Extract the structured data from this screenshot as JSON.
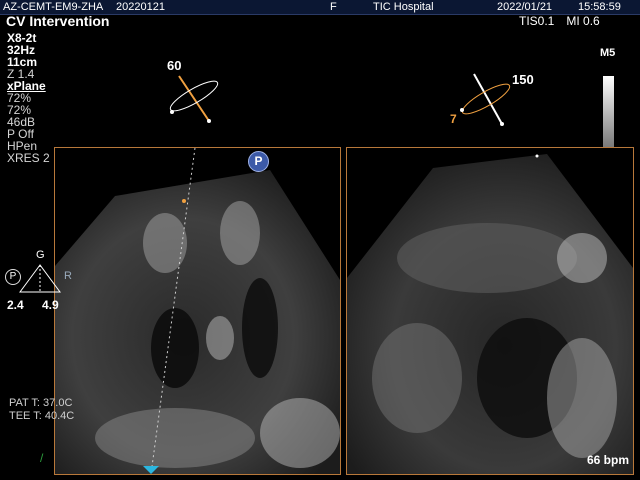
{
  "header": {
    "patient_id": "AZ-CEMT-EM9-ZHA",
    "exam_date": "20220121",
    "f_marker": "F",
    "hospital": "TIC Hospital",
    "date": "2022/01/21",
    "time": "15:58:59"
  },
  "app_title": "CV Intervention",
  "safety": {
    "tis": "TIS0.1",
    "mi": "MI 0.6"
  },
  "imaging_params": {
    "probe": "X8-2t",
    "frame_rate": "32Hz",
    "depth": "11cm",
    "zoom": "Z 1.4",
    "mode": "xPlane",
    "gain1": "72%",
    "gain2": "72%",
    "dynamic_range": "46dB",
    "persistence": "P Off",
    "harmonics": "HPen",
    "xres": "XRES 2"
  },
  "patient_temps": {
    "pat_t": "PAT T: 37.0C",
    "tee_t": "TEE T: 40.4C"
  },
  "angles": {
    "left": "60",
    "right": "150",
    "right_secondary": "7"
  },
  "grayscale_label": "M5",
  "gain_panel": {
    "g_label": "G",
    "p_label": "P",
    "r_label": "R",
    "left_value": "2.4",
    "right_value": "4.9"
  },
  "p_badge": "P",
  "heart_rate": "66 bpm",
  "colors": {
    "header_bg": "#0b1733",
    "pane_border": "#b8783a",
    "angle_line": "#f0a040",
    "p_badge": "#3c5aa8",
    "marker": "#2bb7e0"
  }
}
